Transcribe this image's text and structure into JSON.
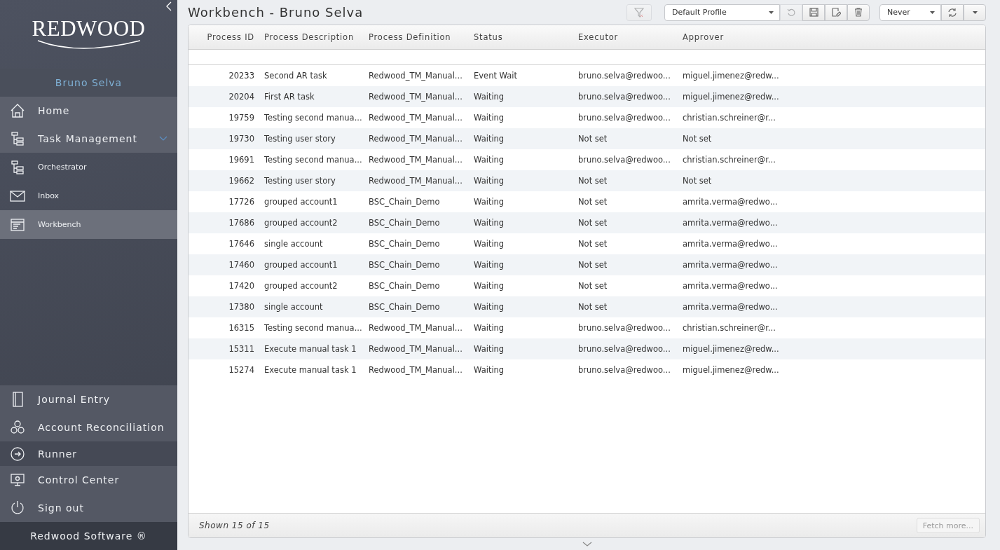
{
  "sidebar": {
    "logo": "REDWOOD",
    "user": "Bruno Selva",
    "items": [
      {
        "label": "Home",
        "kind": "main",
        "selected": false
      },
      {
        "label": "Task Management",
        "kind": "main",
        "selected": false,
        "expanded": true
      },
      {
        "label": "Orchestrator",
        "kind": "sub",
        "selected": false
      },
      {
        "label": "Inbox",
        "kind": "sub",
        "selected": false
      },
      {
        "label": "Workbench",
        "kind": "sub",
        "selected": true
      }
    ],
    "bottom_items": [
      {
        "label": "Journal Entry"
      },
      {
        "label": "Account Reconciliation"
      },
      {
        "label": "Runner"
      },
      {
        "label": "Control Center"
      },
      {
        "label": "Sign out"
      }
    ],
    "footer": "Redwood Software ®"
  },
  "title": "Workbench - Bruno Selva",
  "toolbar": {
    "clear_filter_disabled": true,
    "profile": "Default Profile",
    "undo_disabled": true,
    "refresh_interval": "Never"
  },
  "table": {
    "columns": [
      "Process ID",
      "Process Description",
      "Process Definition",
      "Status",
      "Executor",
      "Approver"
    ],
    "rows": [
      [
        "20233",
        "Second AR task",
        "Redwood_TM_Manual...",
        "Event Wait",
        "bruno.selva@redwoo...",
        "miguel.jimenez@redw..."
      ],
      [
        "20204",
        "First AR task",
        "Redwood_TM_Manual...",
        "Waiting",
        "bruno.selva@redwoo...",
        "miguel.jimenez@redw..."
      ],
      [
        "19759",
        "Testing second manua...",
        "Redwood_TM_Manual...",
        "Waiting",
        "bruno.selva@redwoo...",
        "christian.schreiner@r..."
      ],
      [
        "19730",
        "Testing user story",
        "Redwood_TM_Manual...",
        "Waiting",
        "Not set",
        "Not set"
      ],
      [
        "19691",
        "Testing second manua...",
        "Redwood_TM_Manual...",
        "Waiting",
        "bruno.selva@redwoo...",
        "christian.schreiner@r..."
      ],
      [
        "19662",
        "Testing user story",
        "Redwood_TM_Manual...",
        "Waiting",
        "Not set",
        "Not set"
      ],
      [
        "17726",
        "grouped account1",
        "BSC_Chain_Demo",
        "Waiting",
        "Not set",
        "amrita.verma@redwo..."
      ],
      [
        "17686",
        "grouped account2",
        "BSC_Chain_Demo",
        "Waiting",
        "Not set",
        "amrita.verma@redwo..."
      ],
      [
        "17646",
        "single account",
        "BSC_Chain_Demo",
        "Waiting",
        "Not set",
        "amrita.verma@redwo..."
      ],
      [
        "17460",
        "grouped account1",
        "BSC_Chain_Demo",
        "Waiting",
        "Not set",
        "amrita.verma@redwo..."
      ],
      [
        "17420",
        "grouped account2",
        "BSC_Chain_Demo",
        "Waiting",
        "Not set",
        "amrita.verma@redwo..."
      ],
      [
        "17380",
        "single account",
        "BSC_Chain_Demo",
        "Waiting",
        "Not set",
        "amrita.verma@redwo..."
      ],
      [
        "16315",
        "Testing second manua...",
        "Redwood_TM_Manual...",
        "Waiting",
        "bruno.selva@redwoo...",
        "christian.schreiner@r..."
      ],
      [
        "15311",
        "Execute manual task 1",
        "Redwood_TM_Manual...",
        "Waiting",
        "bruno.selva@redwoo...",
        "miguel.jimenez@redw..."
      ],
      [
        "15274",
        "Execute manual task 1",
        "Redwood_TM_Manual...",
        "Waiting",
        "bruno.selva@redwoo...",
        "miguel.jimenez@redw..."
      ]
    ],
    "status": "Shown 15 of 15",
    "fetch_more": {
      "label": "Fetch more...",
      "disabled": true
    }
  }
}
